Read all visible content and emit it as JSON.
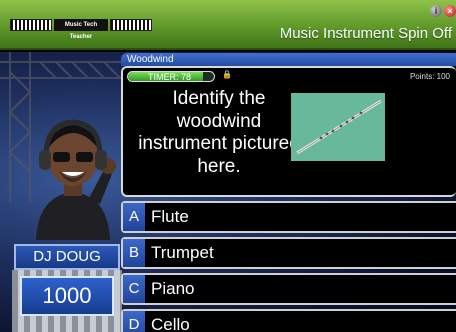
{
  "header": {
    "logo_text": "Music Tech Teacher",
    "logo_url": "www.musictechteacher.com",
    "title": "Music Instrument Spin Off"
  },
  "host": {
    "name": "DJ DOUG",
    "score": "1000"
  },
  "question": {
    "category": "Woodwind",
    "timer_label": "TIMER: 78",
    "timer_progress": 0.87,
    "points_label": "Points: 100",
    "text": "Identify the woodwind instrument pictured here.",
    "image_subject": "flute"
  },
  "answers": [
    {
      "letter": "A",
      "text": "Flute"
    },
    {
      "letter": "B",
      "text": "Trumpet"
    },
    {
      "letter": "C",
      "text": "Piano"
    },
    {
      "letter": "D",
      "text": "Cello"
    }
  ],
  "colors": {
    "header_green": "#5f9a2a",
    "panel_blue": "#2c58b8",
    "image_bg": "#67b99a"
  }
}
